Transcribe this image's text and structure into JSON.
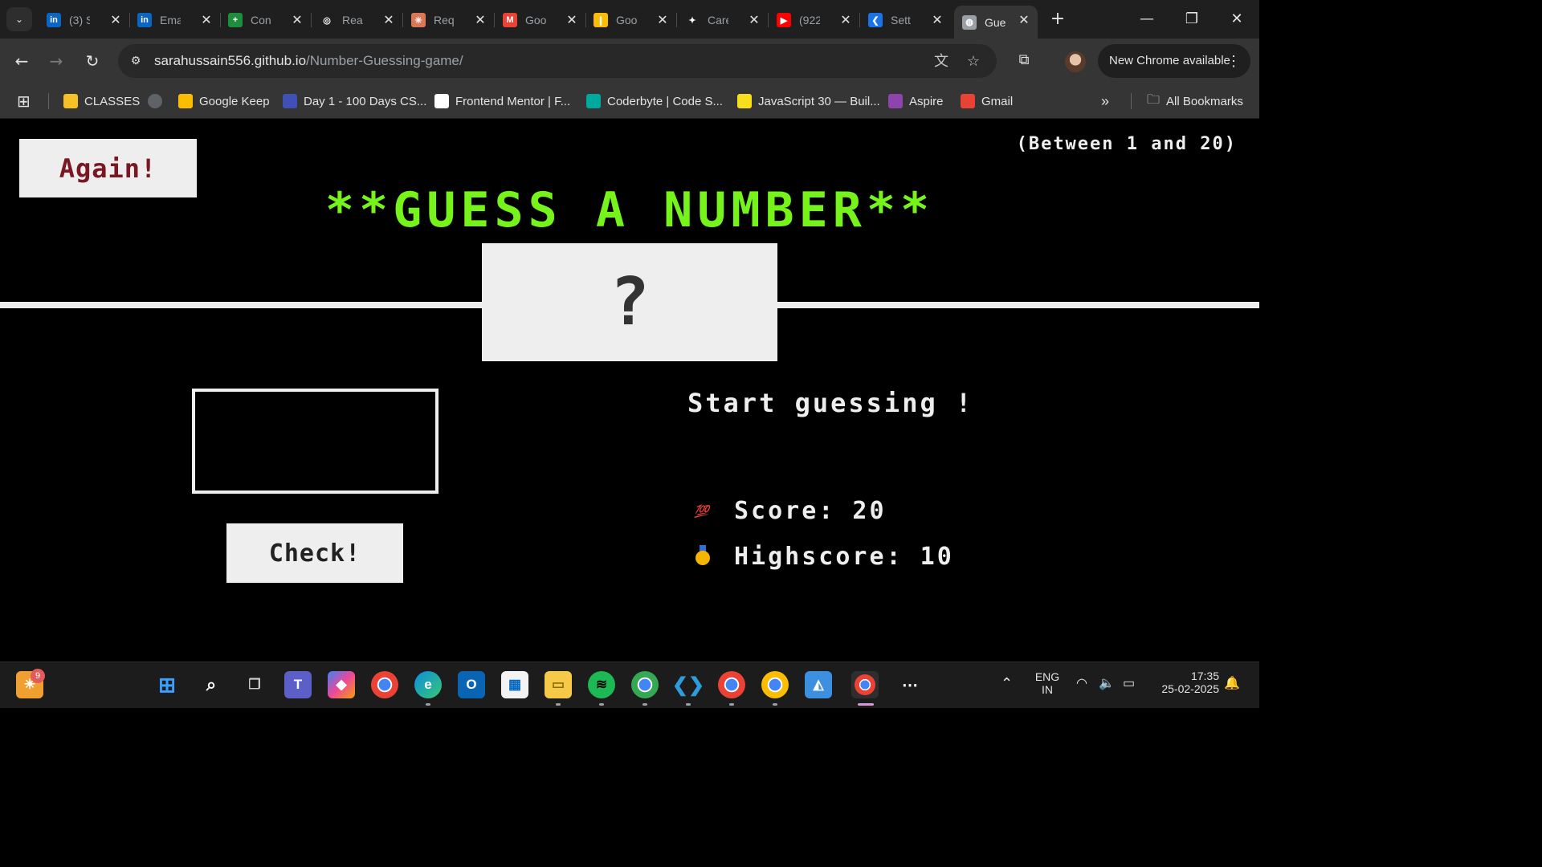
{
  "browser": {
    "tabs": [
      {
        "title": "(3) S",
        "color": "#0a66c2",
        "glyph": "in",
        "active": false
      },
      {
        "title": "Ema",
        "color": "#0a66c2",
        "glyph": "in",
        "active": false
      },
      {
        "title": "Con",
        "color": "#1e8e3e",
        "glyph": "+",
        "active": false
      },
      {
        "title": "Rea",
        "color": "#ffffff",
        "glyph": "◎",
        "active": false
      },
      {
        "title": "Req",
        "color": "#d97757",
        "glyph": "✳",
        "active": false
      },
      {
        "title": "Goo",
        "color": "#ea4335",
        "glyph": "M",
        "active": false
      },
      {
        "title": "Goo",
        "color": "#fbbc04",
        "glyph": "❙",
        "active": false
      },
      {
        "title": "Care",
        "color": "#ffffff",
        "glyph": "✦",
        "active": false
      },
      {
        "title": "(922",
        "color": "#ff0000",
        "glyph": "▶",
        "active": false
      },
      {
        "title": "Sett",
        "color": "#1a73e8",
        "glyph": "❮",
        "active": false
      },
      {
        "title": "Gue",
        "color": "#9aa0a6",
        "glyph": "◍",
        "active": true
      }
    ],
    "url_domain": "sarahussain556.github.io",
    "url_path": "/Number-Guessing-game/",
    "update_label": "New Chrome available",
    "bookmarks": [
      {
        "label": "CLASSES",
        "color": "#f6c026",
        "icon": "classroom-icon"
      },
      {
        "label": "",
        "color": "#5f6368",
        "icon": "globe-icon"
      },
      {
        "label": "Google Keep",
        "color": "#fbbc04",
        "icon": "keep-icon"
      },
      {
        "label": "Day 1 - 100 Days CS...",
        "color": "#3f51b5",
        "icon": "course-icon"
      },
      {
        "label": "Frontend Mentor | F...",
        "color": "#ffffff",
        "icon": "frontend-mentor-icon"
      },
      {
        "label": "Coderbyte | Code S...",
        "color": "#00a99d",
        "icon": "coderbyte-icon"
      },
      {
        "label": "JavaScript 30 — Buil...",
        "color": "#f7df1e",
        "icon": "js30-icon"
      },
      {
        "label": "Aspire",
        "color": "#8e44ad",
        "icon": "aspire-icon"
      },
      {
        "label": "Gmail",
        "color": "#ea4335",
        "icon": "gmail-icon"
      }
    ],
    "all_bookmarks_label": "All Bookmarks"
  },
  "game": {
    "again_label": "Again!",
    "range_hint": "(Between 1 and 20)",
    "title": "**GUESS A NUMBER**",
    "secret_display": "?",
    "guess_value": "",
    "check_label": "Check!",
    "message": "Start guessing !",
    "score_label": "Score: 20",
    "highscore_label": "Highscore: 10",
    "score_emoji": "💯",
    "colors": {
      "accent": "#76f31a",
      "again_text": "#7a1722",
      "panel": "#eeeeee",
      "background": "#000000"
    }
  },
  "taskbar": {
    "widget_badge": "9",
    "language_top": "ENG",
    "language_bottom": "IN",
    "time": "17:35",
    "date": "25-02-2025"
  }
}
